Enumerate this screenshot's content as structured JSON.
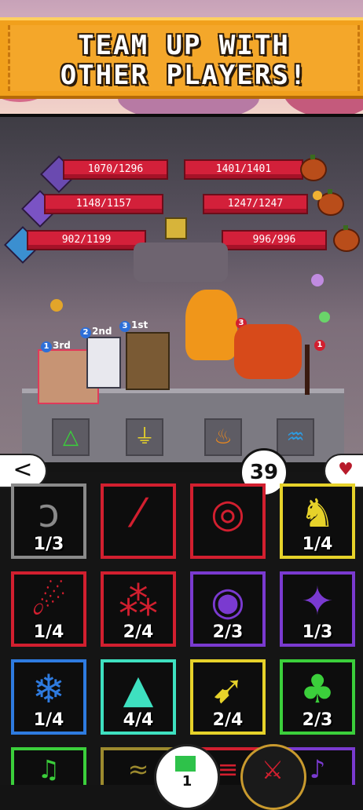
{
  "banner": {
    "line1": "TEAM UP WITH",
    "line2": "OTHER PLAYERS!"
  },
  "party_hp": [
    {
      "text": "1070/1296",
      "value": 1070,
      "max": 1296,
      "gem_color": "#6a4ab0"
    },
    {
      "text": "1148/1157",
      "value": 1148,
      "max": 1157,
      "gem_color": "#7a53c4"
    },
    {
      "text": "902/1199",
      "value": 902,
      "max": 1199,
      "gem_color": "#3b8fd0"
    }
  ],
  "enemy_hp": [
    {
      "text": "1401/1401",
      "value": 1401,
      "max": 1401
    },
    {
      "text": "1247/1247",
      "value": 1247,
      "max": 1247
    },
    {
      "text": "996/996",
      "value": 996,
      "max": 996
    }
  ],
  "party": [
    {
      "badge": "1",
      "rank": "3rd"
    },
    {
      "badge": "2",
      "rank": "2nd"
    },
    {
      "badge": "3",
      "rank": "1st"
    }
  ],
  "enemies": [
    {
      "badge": "3"
    },
    {
      "badge": "1"
    }
  ],
  "runes": [
    "△",
    "⏚",
    "♨",
    "♒"
  ],
  "controls": {
    "back": "<",
    "counter": "39",
    "heart": "♥"
  },
  "skills": [
    {
      "count": "1/3",
      "color": "#8a8a8a",
      "icon": "hook-icon",
      "glyph": "ↄ"
    },
    {
      "count": "",
      "color": "#d21f2f",
      "icon": "slash-icon",
      "glyph": "⁄"
    },
    {
      "count": "",
      "color": "#d21f2f",
      "icon": "ring-icon",
      "glyph": "◎"
    },
    {
      "count": "1/4",
      "color": "#e6d22a",
      "icon": "bird-icon",
      "glyph": "♞"
    },
    {
      "count": "1/4",
      "color": "#d21f2f",
      "icon": "comet-icon",
      "glyph": "☄"
    },
    {
      "count": "2/4",
      "color": "#d21f2f",
      "icon": "spores-icon",
      "glyph": "⁂"
    },
    {
      "count": "2/3",
      "color": "#7a3ad0",
      "icon": "vortex-icon",
      "glyph": "◉"
    },
    {
      "count": "1/3",
      "color": "#7a3ad0",
      "icon": "sparkle-icon",
      "glyph": "✦"
    },
    {
      "count": "1/4",
      "color": "#2e7be0",
      "icon": "ice-icon",
      "glyph": "❄"
    },
    {
      "count": "4/4",
      "color": "#3ee0c0",
      "icon": "light-beam-icon",
      "glyph": "▲"
    },
    {
      "count": "2/4",
      "color": "#e6d22a",
      "icon": "arrows-icon",
      "glyph": "➹"
    },
    {
      "count": "2/3",
      "color": "#3bcf3b",
      "icon": "tree-icon",
      "glyph": "♣"
    }
  ],
  "bottom_row": [
    {
      "color": "#3bcf3b",
      "icon": "rune-music-icon",
      "glyph": "♫"
    },
    {
      "color": "#9c8a2e",
      "icon": "rune-icon",
      "glyph": "≈"
    },
    {
      "color": "#d21f2f",
      "icon": "rune-icon",
      "glyph": "≡"
    },
    {
      "color": "#7a3ad0",
      "icon": "rune-music-icon",
      "glyph": "♪"
    }
  ],
  "footer": {
    "chat_count": "1"
  }
}
